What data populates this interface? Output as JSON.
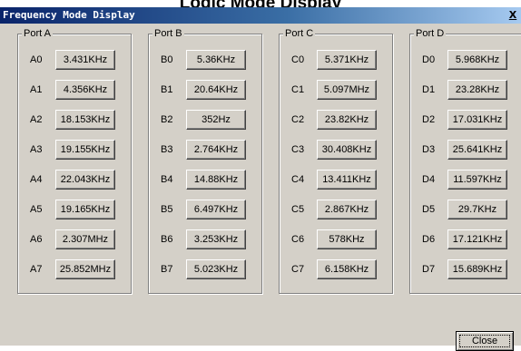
{
  "background_heading": "Logic Mode Display",
  "window": {
    "title": "Frequency Mode Display",
    "close_glyph": "X"
  },
  "ports": [
    {
      "label": "Port A",
      "pins": [
        {
          "name": "A0",
          "value": "3.431KHz"
        },
        {
          "name": "A1",
          "value": "4.356KHz"
        },
        {
          "name": "A2",
          "value": "18.153KHz"
        },
        {
          "name": "A3",
          "value": "19.155KHz"
        },
        {
          "name": "A4",
          "value": "22.043KHz"
        },
        {
          "name": "A5",
          "value": "19.165KHz"
        },
        {
          "name": "A6",
          "value": "2.307MHz"
        },
        {
          "name": "A7",
          "value": "25.852MHz"
        }
      ]
    },
    {
      "label": "Port B",
      "pins": [
        {
          "name": "B0",
          "value": "5.36KHz"
        },
        {
          "name": "B1",
          "value": "20.64KHz"
        },
        {
          "name": "B2",
          "value": "352Hz"
        },
        {
          "name": "B3",
          "value": "2.764KHz"
        },
        {
          "name": "B4",
          "value": "14.88KHz"
        },
        {
          "name": "B5",
          "value": "6.497KHz"
        },
        {
          "name": "B6",
          "value": "3.253KHz"
        },
        {
          "name": "B7",
          "value": "5.023KHz"
        }
      ]
    },
    {
      "label": "Port C",
      "pins": [
        {
          "name": "C0",
          "value": "5.371KHz"
        },
        {
          "name": "C1",
          "value": "5.097MHz"
        },
        {
          "name": "C2",
          "value": "23.82KHz"
        },
        {
          "name": "C3",
          "value": "30.408KHz"
        },
        {
          "name": "C4",
          "value": "13.411KHz"
        },
        {
          "name": "C5",
          "value": "2.867KHz"
        },
        {
          "name": "C6",
          "value": "578KHz"
        },
        {
          "name": "C7",
          "value": "6.158KHz"
        }
      ]
    },
    {
      "label": "Port D",
      "pins": [
        {
          "name": "D0",
          "value": "5.968KHz"
        },
        {
          "name": "D1",
          "value": "23.28KHz"
        },
        {
          "name": "D2",
          "value": "17.031KHz"
        },
        {
          "name": "D3",
          "value": "25.641KHz"
        },
        {
          "name": "D4",
          "value": "11.597KHz"
        },
        {
          "name": "D5",
          "value": "29.7KHz"
        },
        {
          "name": "D6",
          "value": "17.121KHz"
        },
        {
          "name": "D7",
          "value": "15.689KHz"
        }
      ]
    }
  ],
  "buttons": {
    "close_label": "Close"
  },
  "colors": {
    "dialog_face": "#d4d0c8",
    "titlebar_start": "#0a246a",
    "titlebar_end": "#a6caf0",
    "title_text": "#ffffff"
  }
}
